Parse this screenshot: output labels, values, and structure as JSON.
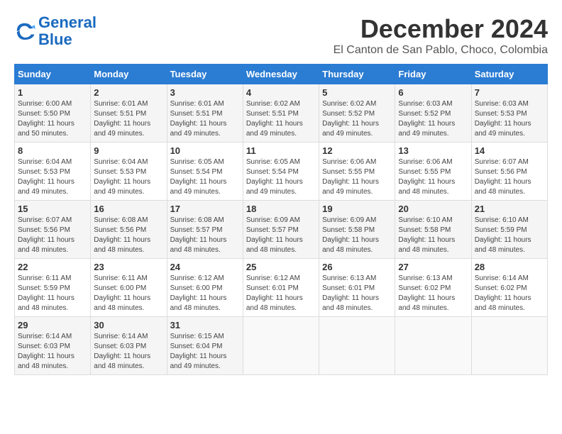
{
  "header": {
    "logo_line1": "General",
    "logo_line2": "Blue",
    "month_title": "December 2024",
    "location": "El Canton de San Pablo, Choco, Colombia"
  },
  "days_of_week": [
    "Sunday",
    "Monday",
    "Tuesday",
    "Wednesday",
    "Thursday",
    "Friday",
    "Saturday"
  ],
  "weeks": [
    [
      {
        "day": "1",
        "sunrise": "6:00 AM",
        "sunset": "5:50 PM",
        "daylight": "11 hours and 50 minutes."
      },
      {
        "day": "2",
        "sunrise": "6:01 AM",
        "sunset": "5:51 PM",
        "daylight": "11 hours and 49 minutes."
      },
      {
        "day": "3",
        "sunrise": "6:01 AM",
        "sunset": "5:51 PM",
        "daylight": "11 hours and 49 minutes."
      },
      {
        "day": "4",
        "sunrise": "6:02 AM",
        "sunset": "5:51 PM",
        "daylight": "11 hours and 49 minutes."
      },
      {
        "day": "5",
        "sunrise": "6:02 AM",
        "sunset": "5:52 PM",
        "daylight": "11 hours and 49 minutes."
      },
      {
        "day": "6",
        "sunrise": "6:03 AM",
        "sunset": "5:52 PM",
        "daylight": "11 hours and 49 minutes."
      },
      {
        "day": "7",
        "sunrise": "6:03 AM",
        "sunset": "5:53 PM",
        "daylight": "11 hours and 49 minutes."
      }
    ],
    [
      {
        "day": "8",
        "sunrise": "6:04 AM",
        "sunset": "5:53 PM",
        "daylight": "11 hours and 49 minutes."
      },
      {
        "day": "9",
        "sunrise": "6:04 AM",
        "sunset": "5:53 PM",
        "daylight": "11 hours and 49 minutes."
      },
      {
        "day": "10",
        "sunrise": "6:05 AM",
        "sunset": "5:54 PM",
        "daylight": "11 hours and 49 minutes."
      },
      {
        "day": "11",
        "sunrise": "6:05 AM",
        "sunset": "5:54 PM",
        "daylight": "11 hours and 49 minutes."
      },
      {
        "day": "12",
        "sunrise": "6:06 AM",
        "sunset": "5:55 PM",
        "daylight": "11 hours and 49 minutes."
      },
      {
        "day": "13",
        "sunrise": "6:06 AM",
        "sunset": "5:55 PM",
        "daylight": "11 hours and 48 minutes."
      },
      {
        "day": "14",
        "sunrise": "6:07 AM",
        "sunset": "5:56 PM",
        "daylight": "11 hours and 48 minutes."
      }
    ],
    [
      {
        "day": "15",
        "sunrise": "6:07 AM",
        "sunset": "5:56 PM",
        "daylight": "11 hours and 48 minutes."
      },
      {
        "day": "16",
        "sunrise": "6:08 AM",
        "sunset": "5:56 PM",
        "daylight": "11 hours and 48 minutes."
      },
      {
        "day": "17",
        "sunrise": "6:08 AM",
        "sunset": "5:57 PM",
        "daylight": "11 hours and 48 minutes."
      },
      {
        "day": "18",
        "sunrise": "6:09 AM",
        "sunset": "5:57 PM",
        "daylight": "11 hours and 48 minutes."
      },
      {
        "day": "19",
        "sunrise": "6:09 AM",
        "sunset": "5:58 PM",
        "daylight": "11 hours and 48 minutes."
      },
      {
        "day": "20",
        "sunrise": "6:10 AM",
        "sunset": "5:58 PM",
        "daylight": "11 hours and 48 minutes."
      },
      {
        "day": "21",
        "sunrise": "6:10 AM",
        "sunset": "5:59 PM",
        "daylight": "11 hours and 48 minutes."
      }
    ],
    [
      {
        "day": "22",
        "sunrise": "6:11 AM",
        "sunset": "5:59 PM",
        "daylight": "11 hours and 48 minutes."
      },
      {
        "day": "23",
        "sunrise": "6:11 AM",
        "sunset": "6:00 PM",
        "daylight": "11 hours and 48 minutes."
      },
      {
        "day": "24",
        "sunrise": "6:12 AM",
        "sunset": "6:00 PM",
        "daylight": "11 hours and 48 minutes."
      },
      {
        "day": "25",
        "sunrise": "6:12 AM",
        "sunset": "6:01 PM",
        "daylight": "11 hours and 48 minutes."
      },
      {
        "day": "26",
        "sunrise": "6:13 AM",
        "sunset": "6:01 PM",
        "daylight": "11 hours and 48 minutes."
      },
      {
        "day": "27",
        "sunrise": "6:13 AM",
        "sunset": "6:02 PM",
        "daylight": "11 hours and 48 minutes."
      },
      {
        "day": "28",
        "sunrise": "6:14 AM",
        "sunset": "6:02 PM",
        "daylight": "11 hours and 48 minutes."
      }
    ],
    [
      {
        "day": "29",
        "sunrise": "6:14 AM",
        "sunset": "6:03 PM",
        "daylight": "11 hours and 48 minutes."
      },
      {
        "day": "30",
        "sunrise": "6:14 AM",
        "sunset": "6:03 PM",
        "daylight": "11 hours and 48 minutes."
      },
      {
        "day": "31",
        "sunrise": "6:15 AM",
        "sunset": "6:04 PM",
        "daylight": "11 hours and 49 minutes."
      },
      null,
      null,
      null,
      null
    ]
  ]
}
